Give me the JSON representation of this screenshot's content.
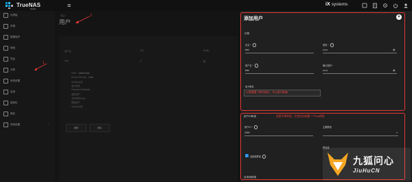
{
  "topbar": {
    "brand": "TrueNAS",
    "brand_sub": "SCALE",
    "vendor_prefix": "iX",
    "vendor_name": "systems"
  },
  "sidebar": {
    "items": [
      {
        "label": "仪表板"
      },
      {
        "label": "存储"
      },
      {
        "label": "数据保护"
      },
      {
        "label": "网络"
      },
      {
        "label": "凭证"
      },
      {
        "label": "共享"
      },
      {
        "label": "系统设置"
      },
      {
        "label": "应用"
      },
      {
        "label": "虚拟化"
      },
      {
        "label": "报告"
      },
      {
        "label": "系统设置",
        "chevron": "›"
      }
    ]
  },
  "main": {
    "breadcrumb": "凭证 ›",
    "title": "用户",
    "headers": [
      "用户名",
      "UID",
      "Builtin",
      "全名"
    ],
    "row": [
      "root",
      "0",
      "是",
      ""
    ],
    "details": [
      {
        "label": "Shell",
        "value": "/usr/bin/zsh"
      },
      {
        "label": "Home Directory",
        "value": "/root"
      },
      {
        "label": "Samba认证",
        "value": ""
      },
      {
        "label": "电子邮件",
        "value": ""
      },
      {
        "label": "Password Disabled",
        "value": ""
      },
      {
        "label": "锁定用户",
        "value": ""
      },
      {
        "label": "允许所有Sudo",
        "value": ""
      },
      {
        "label": "群组用户",
        "value": ""
      },
      {
        "label": "Samba认证",
        "value": ""
      }
    ],
    "edit_button": "编辑",
    "delete_button": "删除"
  },
  "annotations": {
    "one": "1",
    "two": "2"
  },
  "panel": {
    "title": "添加用户",
    "close": "×",
    "section_identity": "识别",
    "fullname_label": "全名 *",
    "fullname_value": "test",
    "password_label": "密码 *",
    "password_value": "••••••",
    "username_label": "用户名 *",
    "username_value": "test",
    "confirm_label": "确认密码 *",
    "confirm_value": "••••••",
    "email_label": "电子邮件",
    "email_hint": "以便提醒了邮件服务，可以填写邮箱",
    "section_ids": "用户ID和组",
    "ids_hint": "这里不改的话，它会自动创建一个test的组",
    "uid_label": "用户ID *",
    "uid_value": "1000",
    "aux_group_label": "主要群组",
    "auto_group_label": "创建新群组",
    "groups_label": "附加组",
    "section_dirs": "目录和权限"
  },
  "watermark": {
    "cn": "九狐问心",
    "en": "JiuHuCN"
  },
  "colors": {
    "annotation_red": "#e53935",
    "checkbox_blue": "#1e88e5"
  }
}
